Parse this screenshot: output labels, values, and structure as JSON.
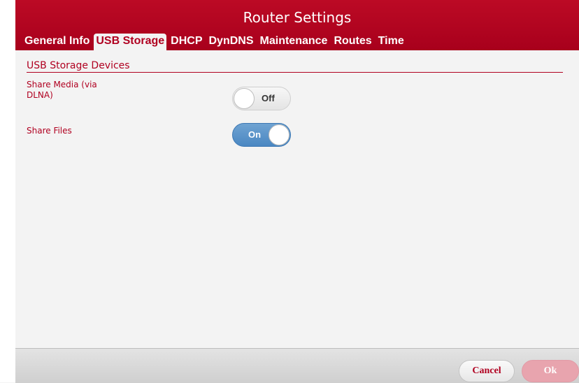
{
  "header": {
    "title": "Router Settings",
    "tabs": [
      {
        "label": "General Info"
      },
      {
        "label": "USB Storage",
        "active": true
      },
      {
        "label": "DHCP"
      },
      {
        "label": "DynDNS"
      },
      {
        "label": "Maintenance"
      },
      {
        "label": "Routes"
      },
      {
        "label": "Time"
      }
    ]
  },
  "main": {
    "section_title": "USB Storage Devices",
    "settings": [
      {
        "label_line1": "Share Media (via",
        "label_line2": "DLNA)",
        "state": "Off"
      },
      {
        "label": "Share Files",
        "state": "On"
      }
    ]
  },
  "footer": {
    "cancel_label": "Cancel",
    "ok_label": "Ok"
  },
  "colors": {
    "accent": "#b00020",
    "toggle_on": "#4a87c2",
    "background": "#f3f3f3"
  }
}
